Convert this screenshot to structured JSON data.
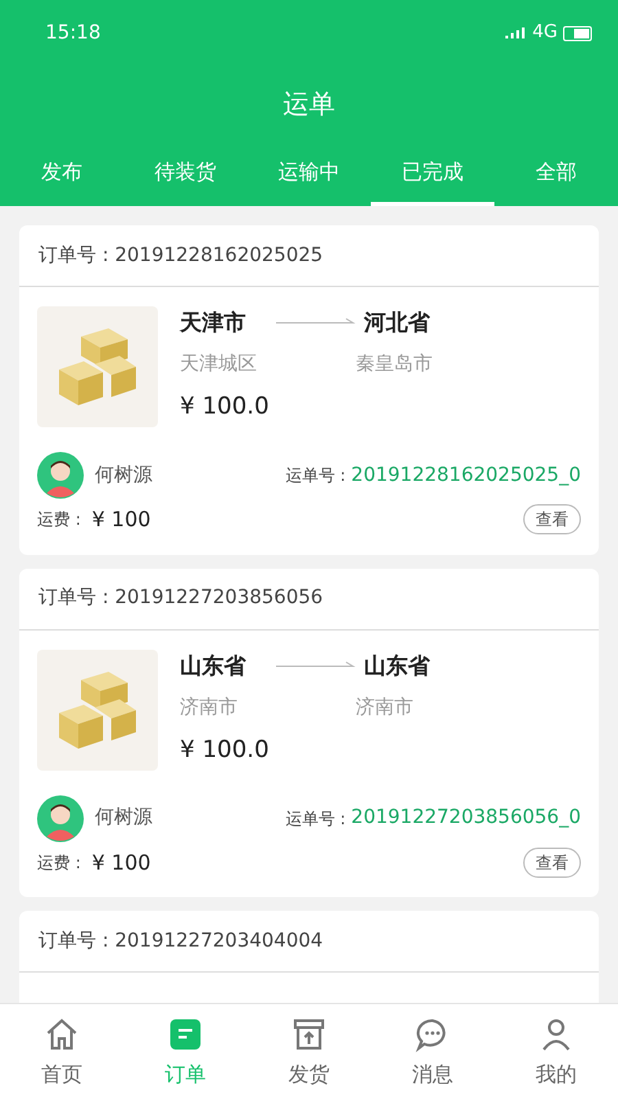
{
  "status_bar": {
    "time": "15:18",
    "network": "4G"
  },
  "header": {
    "title": "运单"
  },
  "tabs": [
    {
      "label": "发布",
      "selected": false
    },
    {
      "label": "待装货",
      "selected": false
    },
    {
      "label": "运输中",
      "selected": false
    },
    {
      "label": "已完成",
      "selected": true
    },
    {
      "label": "全部",
      "selected": false
    }
  ],
  "orders": [
    {
      "order_label": "订单号 : ",
      "order_no": "20191228162025025",
      "from_city": "天津市",
      "to_city": "河北省",
      "from_district": "天津城区",
      "to_district": "秦皇岛市",
      "price": "¥ 100.0",
      "driver": "何树源",
      "waybill_label": "运单号 : ",
      "waybill_no": "20191228162025025_0",
      "fee_label": "运费 : ",
      "fee": "¥ 100",
      "view_button": "查看"
    },
    {
      "order_label": "订单号 : ",
      "order_no": "20191227203856056",
      "from_city": "山东省",
      "to_city": "山东省",
      "from_district": "济南市",
      "to_district": "济南市",
      "price": "¥ 100.0",
      "driver": "何树源",
      "waybill_label": "运单号 : ",
      "waybill_no": "20191227203856056_0",
      "fee_label": "运费 : ",
      "fee": "¥ 100",
      "view_button": "查看"
    },
    {
      "order_label": "订单号 : ",
      "order_no": "20191227203404004"
    }
  ],
  "bottom_nav": [
    {
      "label": "首页",
      "kind": "home",
      "selected": false
    },
    {
      "label": "订单",
      "kind": "orders",
      "selected": true
    },
    {
      "label": "发货",
      "kind": "ship",
      "selected": false
    },
    {
      "label": "消息",
      "kind": "messages",
      "selected": false
    },
    {
      "label": "我的",
      "kind": "profile",
      "selected": false
    }
  ]
}
